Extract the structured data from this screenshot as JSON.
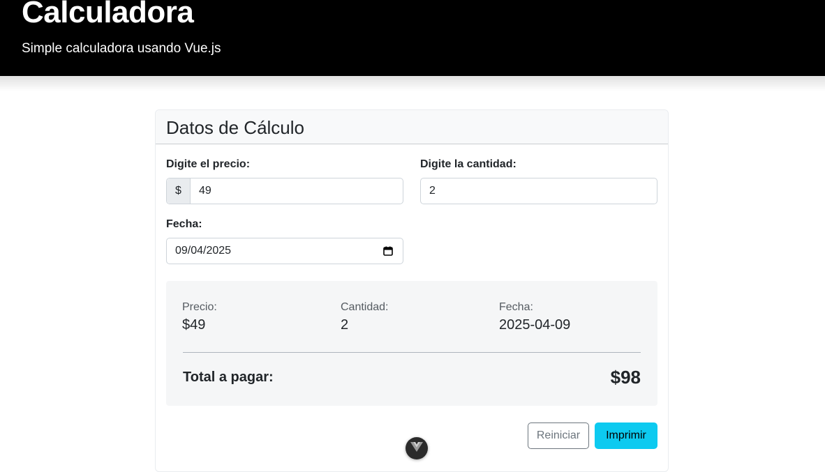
{
  "header": {
    "title": "Calculadora",
    "subtitle": "Simple calculadora usando Vue.js"
  },
  "card": {
    "title": "Datos de Cálculo"
  },
  "form": {
    "price_label": "Digite el precio:",
    "price_prefix": "$",
    "price_value": "49",
    "quantity_label": "Digite la cantidad:",
    "quantity_value": "2",
    "date_label": "Fecha:",
    "date_value": "09/04/2025"
  },
  "summary": {
    "price_label": "Precio:",
    "price_value": "$49",
    "quantity_label": "Cantidad:",
    "quantity_value": "2",
    "date_label": "Fecha:",
    "date_value": "2025-04-09",
    "total_label": "Total a pagar:",
    "total_value": "$98"
  },
  "buttons": {
    "reset_label": "Reiniciar",
    "print_label": "Imprimir"
  },
  "icons": {
    "calendar": "calendar-icon",
    "floating": "vue-logo-icon"
  },
  "colors": {
    "header_bg": "#000000",
    "print_button": "#0dcaf0",
    "reset_button_border": "#6c757d"
  }
}
